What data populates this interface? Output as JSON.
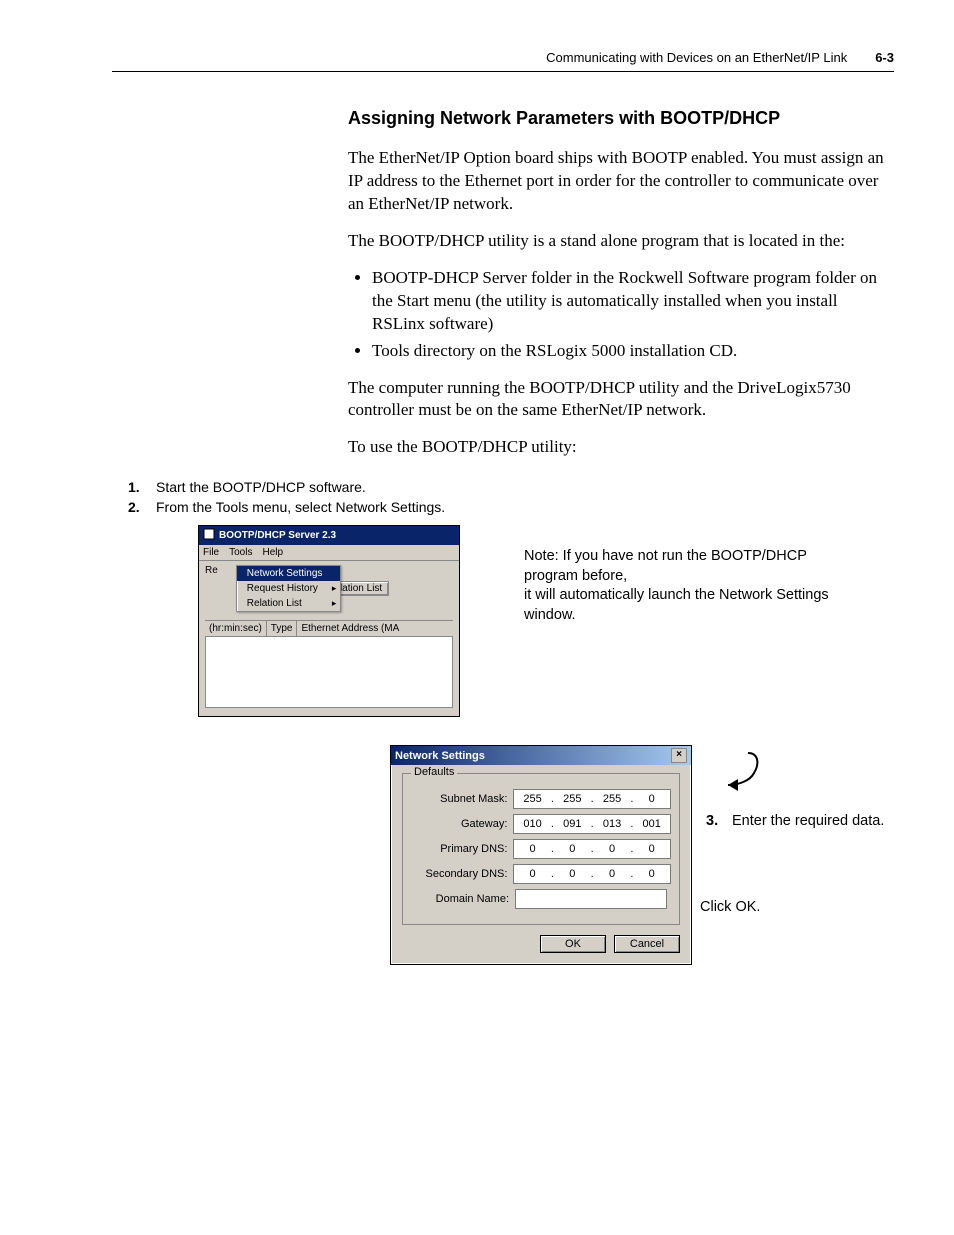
{
  "header": {
    "title": "Communicating with Devices on an EtherNet/IP Link",
    "page_no": "6-3"
  },
  "section": {
    "heading": "Assigning Network Parameters with BOOTP/DHCP",
    "p1": "The EtherNet/IP Option board ships with BOOTP enabled. You must assign an IP address to the Ethernet port in order for the controller to communicate over an EtherNet/IP network.",
    "p2": "The BOOTP/DHCP utility is a stand alone program that is located in the:",
    "bullets": [
      "BOOTP-DHCP Server folder in the Rockwell Software program folder on the Start menu (the utility is automatically installed when you install RSLinx software)",
      "Tools directory on the RSLogix 5000 installation CD."
    ],
    "p3": "The computer running the BOOTP/DHCP utility and the DriveLogix5730 controller must be on the same EtherNet/IP network.",
    "p4": "To use the BOOTP/DHCP utility:"
  },
  "steps": {
    "s1_num": "1.",
    "s1_text": "Start the BOOTP/DHCP software.",
    "s2_num": "2.",
    "s2_text": "From the Tools menu, select Network Settings."
  },
  "bootp": {
    "window_title": "BOOTP/DHCP Server 2.3",
    "menu_file": "File",
    "menu_tools": "Tools",
    "menu_help": "Help",
    "re_label": "Re",
    "menu_item_net": "Network Settings",
    "menu_item_hist": "Request History",
    "menu_item_rel": "Relation List",
    "btn_relation": "elation List",
    "col1": "(hr:min:sec)",
    "col2": "Type",
    "col3": "Ethernet Address (MA"
  },
  "note": {
    "text_l1": "Note: If you have not run the BOOTP/DHCP program before,",
    "text_l2": "it will automatically launch the Network Settings window."
  },
  "dialog": {
    "title": "Network Settings",
    "close": "×",
    "group": "Defaults",
    "subnet_label": "Subnet Mask:",
    "subnet": [
      "255",
      "255",
      "255",
      "0"
    ],
    "gateway_label": "Gateway:",
    "gateway": [
      "010",
      "091",
      "013",
      "001"
    ],
    "pdns_label": "Primary DNS:",
    "pdns": [
      "0",
      "0",
      "0",
      "0"
    ],
    "sdns_label": "Secondary DNS:",
    "sdns": [
      "0",
      "0",
      "0",
      "0"
    ],
    "domain_label": "Domain Name:",
    "ok": "OK",
    "cancel": "Cancel"
  },
  "step3": {
    "num": "3.",
    "text": "Enter the required data."
  },
  "clickok": "Click OK."
}
